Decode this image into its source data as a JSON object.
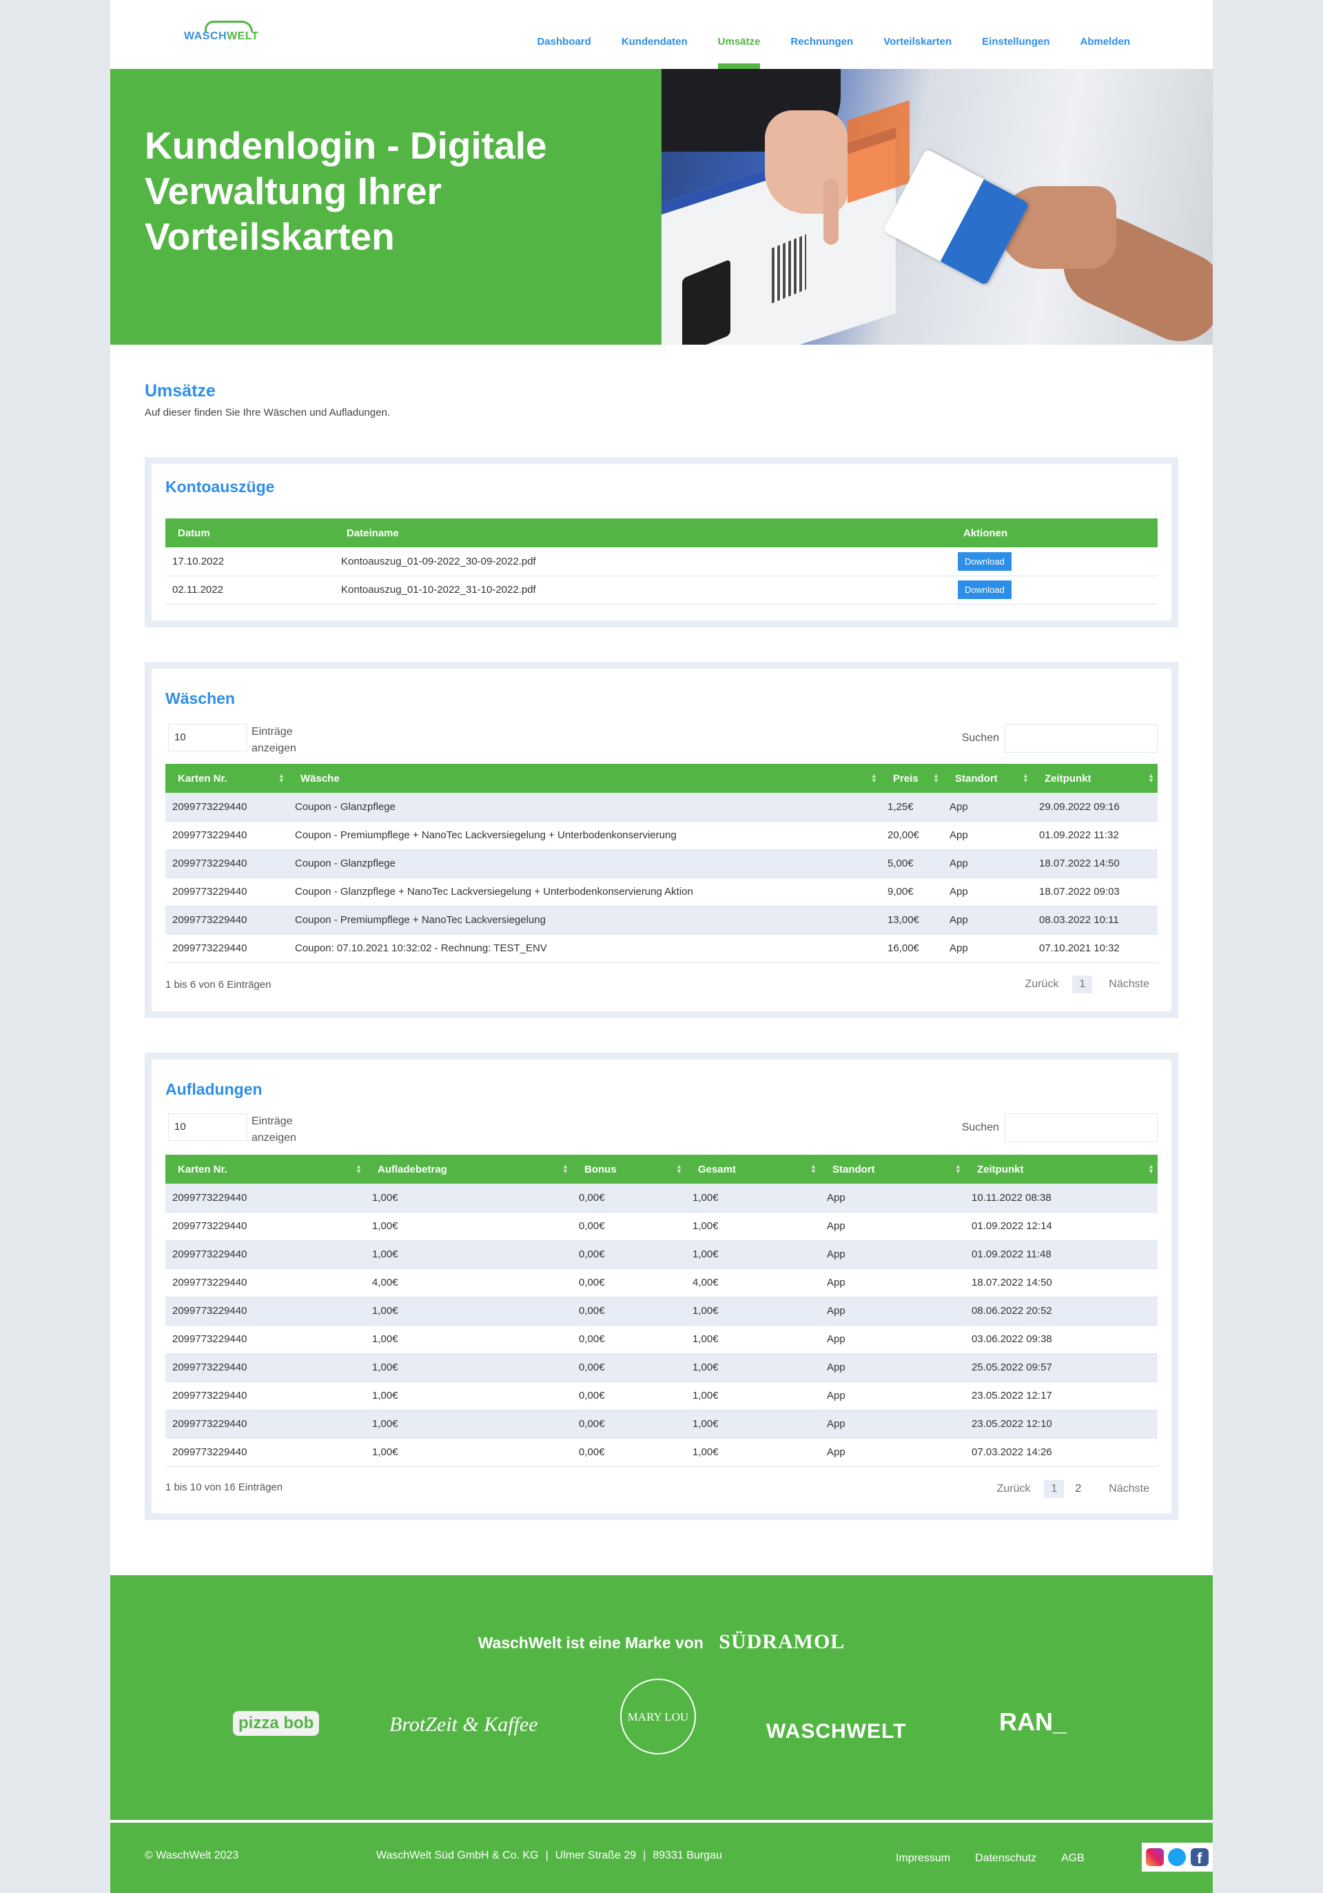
{
  "header": {
    "logo": {
      "part1": "WASCH",
      "part2": "WELT"
    },
    "nav": [
      {
        "label": "Dashboard",
        "active": false
      },
      {
        "label": "Kundendaten",
        "active": false
      },
      {
        "label": "Umsätze",
        "active": true
      },
      {
        "label": "Rechnungen",
        "active": false
      },
      {
        "label": "Vorteilskarten",
        "active": false
      },
      {
        "label": "Einstellungen",
        "active": false
      },
      {
        "label": "Abmelden",
        "active": false
      }
    ]
  },
  "hero": {
    "title": "Kundenlogin - Digitale Verwaltung Ihrer Vorteilskarten",
    "image_alt": "Hand übergibt WaschWelt Vorteilskarte"
  },
  "intro": {
    "title": "Umsätze",
    "subtitle": "Auf dieser finden Sie Ihre Wäschen und Aufladungen."
  },
  "kontoauszuege": {
    "title": "Kontoauszüge",
    "columns": [
      "Datum",
      "Dateiname",
      "Aktionen"
    ],
    "rows": [
      {
        "datum": "17.10.2022",
        "datei": "Kontoauszug_01-09-2022_30-09-2022.pdf",
        "action": "Download"
      },
      {
        "datum": "02.11.2022",
        "datei": "Kontoauszug_01-10-2022_31-10-2022.pdf",
        "action": "Download"
      }
    ]
  },
  "waeschen": {
    "title": "Wäschen",
    "length_value": "10",
    "length_label_1": "Einträge",
    "length_label_2": "anzeigen",
    "search_label": "Suchen",
    "search_value": "",
    "columns": [
      "Karten Nr.",
      "Wäsche",
      "Preis",
      "Standort",
      "Zeitpunkt"
    ],
    "rows": [
      [
        "2099773229440",
        "Coupon - Glanzpflege",
        "1,25€",
        "App",
        "29.09.2022 09:16"
      ],
      [
        "2099773229440",
        "Coupon - Premiumpflege + NanoTec Lackversiegelung + Unterbodenkonservierung",
        "20,00€",
        "App",
        "01.09.2022 11:32"
      ],
      [
        "2099773229440",
        "Coupon - Glanzpflege",
        "5,00€",
        "App",
        "18.07.2022 14:50"
      ],
      [
        "2099773229440",
        "Coupon - Glanzpflege + NanoTec Lackversiegelung + Unterbodenkonservierung Aktion",
        "9,00€",
        "App",
        "18.07.2022 09:03"
      ],
      [
        "2099773229440",
        "Coupon - Premiumpflege + NanoTec Lackversiegelung",
        "13,00€",
        "App",
        "08.03.2022 10:11"
      ],
      [
        "2099773229440",
        "Coupon: 07.10.2021 10:32:02 - Rechnung: TEST_ENV",
        "16,00€",
        "App",
        "07.10.2021 10:32"
      ]
    ],
    "info": "1 bis 6 von 6 Einträgen",
    "pager": {
      "prev": "Zurück",
      "pages": [
        "1"
      ],
      "current": "1",
      "next": "Nächste"
    }
  },
  "aufladungen": {
    "title": "Aufladungen",
    "length_value": "10",
    "length_label_1": "Einträge",
    "length_label_2": "anzeigen",
    "search_label": "Suchen",
    "search_value": "",
    "columns": [
      "Karten Nr.",
      "Aufladebetrag",
      "Bonus",
      "Gesamt",
      "Standort",
      "Zeitpunkt"
    ],
    "rows": [
      [
        "2099773229440",
        "1,00€",
        "0,00€",
        "1,00€",
        "App",
        "10.11.2022 08:38"
      ],
      [
        "2099773229440",
        "1,00€",
        "0,00€",
        "1,00€",
        "App",
        "01.09.2022 12:14"
      ],
      [
        "2099773229440",
        "1,00€",
        "0,00€",
        "1,00€",
        "App",
        "01.09.2022 11:48"
      ],
      [
        "2099773229440",
        "4,00€",
        "0,00€",
        "4,00€",
        "App",
        "18.07.2022 14:50"
      ],
      [
        "2099773229440",
        "1,00€",
        "0,00€",
        "1,00€",
        "App",
        "08.06.2022 20:52"
      ],
      [
        "2099773229440",
        "1,00€",
        "0,00€",
        "1,00€",
        "App",
        "03.06.2022 09:38"
      ],
      [
        "2099773229440",
        "1,00€",
        "0,00€",
        "1,00€",
        "App",
        "25.05.2022 09:57"
      ],
      [
        "2099773229440",
        "1,00€",
        "0,00€",
        "1,00€",
        "App",
        "23.05.2022 12:17"
      ],
      [
        "2099773229440",
        "1,00€",
        "0,00€",
        "1,00€",
        "App",
        "23.05.2022 12:10"
      ],
      [
        "2099773229440",
        "1,00€",
        "0,00€",
        "1,00€",
        "App",
        "07.03.2022 14:26"
      ]
    ],
    "info": "1 bis 10 von 16 Einträgen",
    "pager": {
      "prev": "Zurück",
      "pages": [
        "1",
        "2"
      ],
      "current": "1",
      "next": "Nächste"
    }
  },
  "footer": {
    "brand_text": "WaschWelt ist eine Marke von",
    "brand_logo": "SÜDRAMOL",
    "partner_logos": [
      "pizza bob",
      "BrotZeit & Kaffee",
      "MARY LOU",
      "WASCHWELT",
      "RAN_"
    ],
    "copyright": "© WaschWelt 2023",
    "address": [
      "WaschWelt Süd GmbH & Co. KG",
      "Ulmer Straße 29",
      "89331 Burgau"
    ],
    "links": [
      "Impressum",
      "Datenschutz",
      "AGB"
    ],
    "social": [
      "instagram-icon",
      "twitter-icon",
      "facebook-icon"
    ]
  },
  "colors": {
    "brand_green": "#53b544",
    "brand_blue": "#2d8ee8",
    "row_alt": "#e8ecf5",
    "page_bg": "#e4e8ec"
  }
}
